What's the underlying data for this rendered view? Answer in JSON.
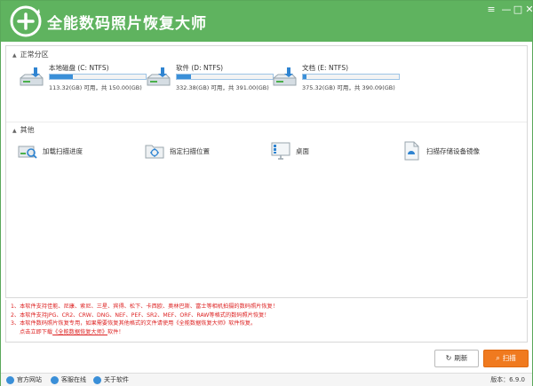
{
  "window": {
    "title": "全能数码照片恢复大师",
    "controls": {
      "menu": "≡",
      "minimize": "—",
      "maximize": "□",
      "close": "✕"
    }
  },
  "partitions": {
    "heading": "正常分区",
    "drives": [
      {
        "label": "本地磁盘 (C: NTFS)",
        "size_text": "113.32(GB) 可用，共 150.00(GB)",
        "used_fraction": 0.245
      },
      {
        "label": "软件 (D: NTFS)",
        "size_text": "332.38(GB) 可用，共 391.00(GB)",
        "used_fraction": 0.15
      },
      {
        "label": "文档 (E: NTFS)",
        "size_text": "375.32(GB) 可用，共 390.09(GB)",
        "used_fraction": 0.04
      }
    ]
  },
  "other": {
    "heading": "其他",
    "items": [
      {
        "label": "加载扫描进度",
        "icon": "load-progress-icon"
      },
      {
        "label": "指定扫描位置",
        "icon": "target-folder-icon"
      },
      {
        "label": "桌面",
        "icon": "desktop-icon"
      },
      {
        "label": "扫描存储设备镜像",
        "icon": "disk-image-icon"
      }
    ]
  },
  "notes": {
    "line1": "1、本软件支持佳能、尼康、索尼、三星、宾得、松下、卡西欧、奥林巴斯、富士等相机拍摄的数码照片恢复！",
    "line2": "2、本软件支持JPG、CR2、CRW、DNG、NEF、PEF、SR2、MEF、ORF、RAW等格式的数码照片恢复！",
    "line3": "3、本软件数码照片恢复专用，如果需要恢复其他格式的文件请使用《全能数据恢复大师》软件恢复。",
    "line4_prefix": "点击立即下载",
    "line4_link": "《全能数据恢复大师》",
    "line4_suffix": "软件！"
  },
  "buttons": {
    "refresh": "刷新",
    "scan": "扫描"
  },
  "statusbar": {
    "website": "官方网站",
    "support": "客服在线",
    "about": "关于软件",
    "version": "版本：6.9.0"
  },
  "colors": {
    "titlebar": "#5fb35f",
    "accent": "#f07a1f",
    "bar_fill": "#3a8fd8",
    "note_text": "#dd2222"
  }
}
